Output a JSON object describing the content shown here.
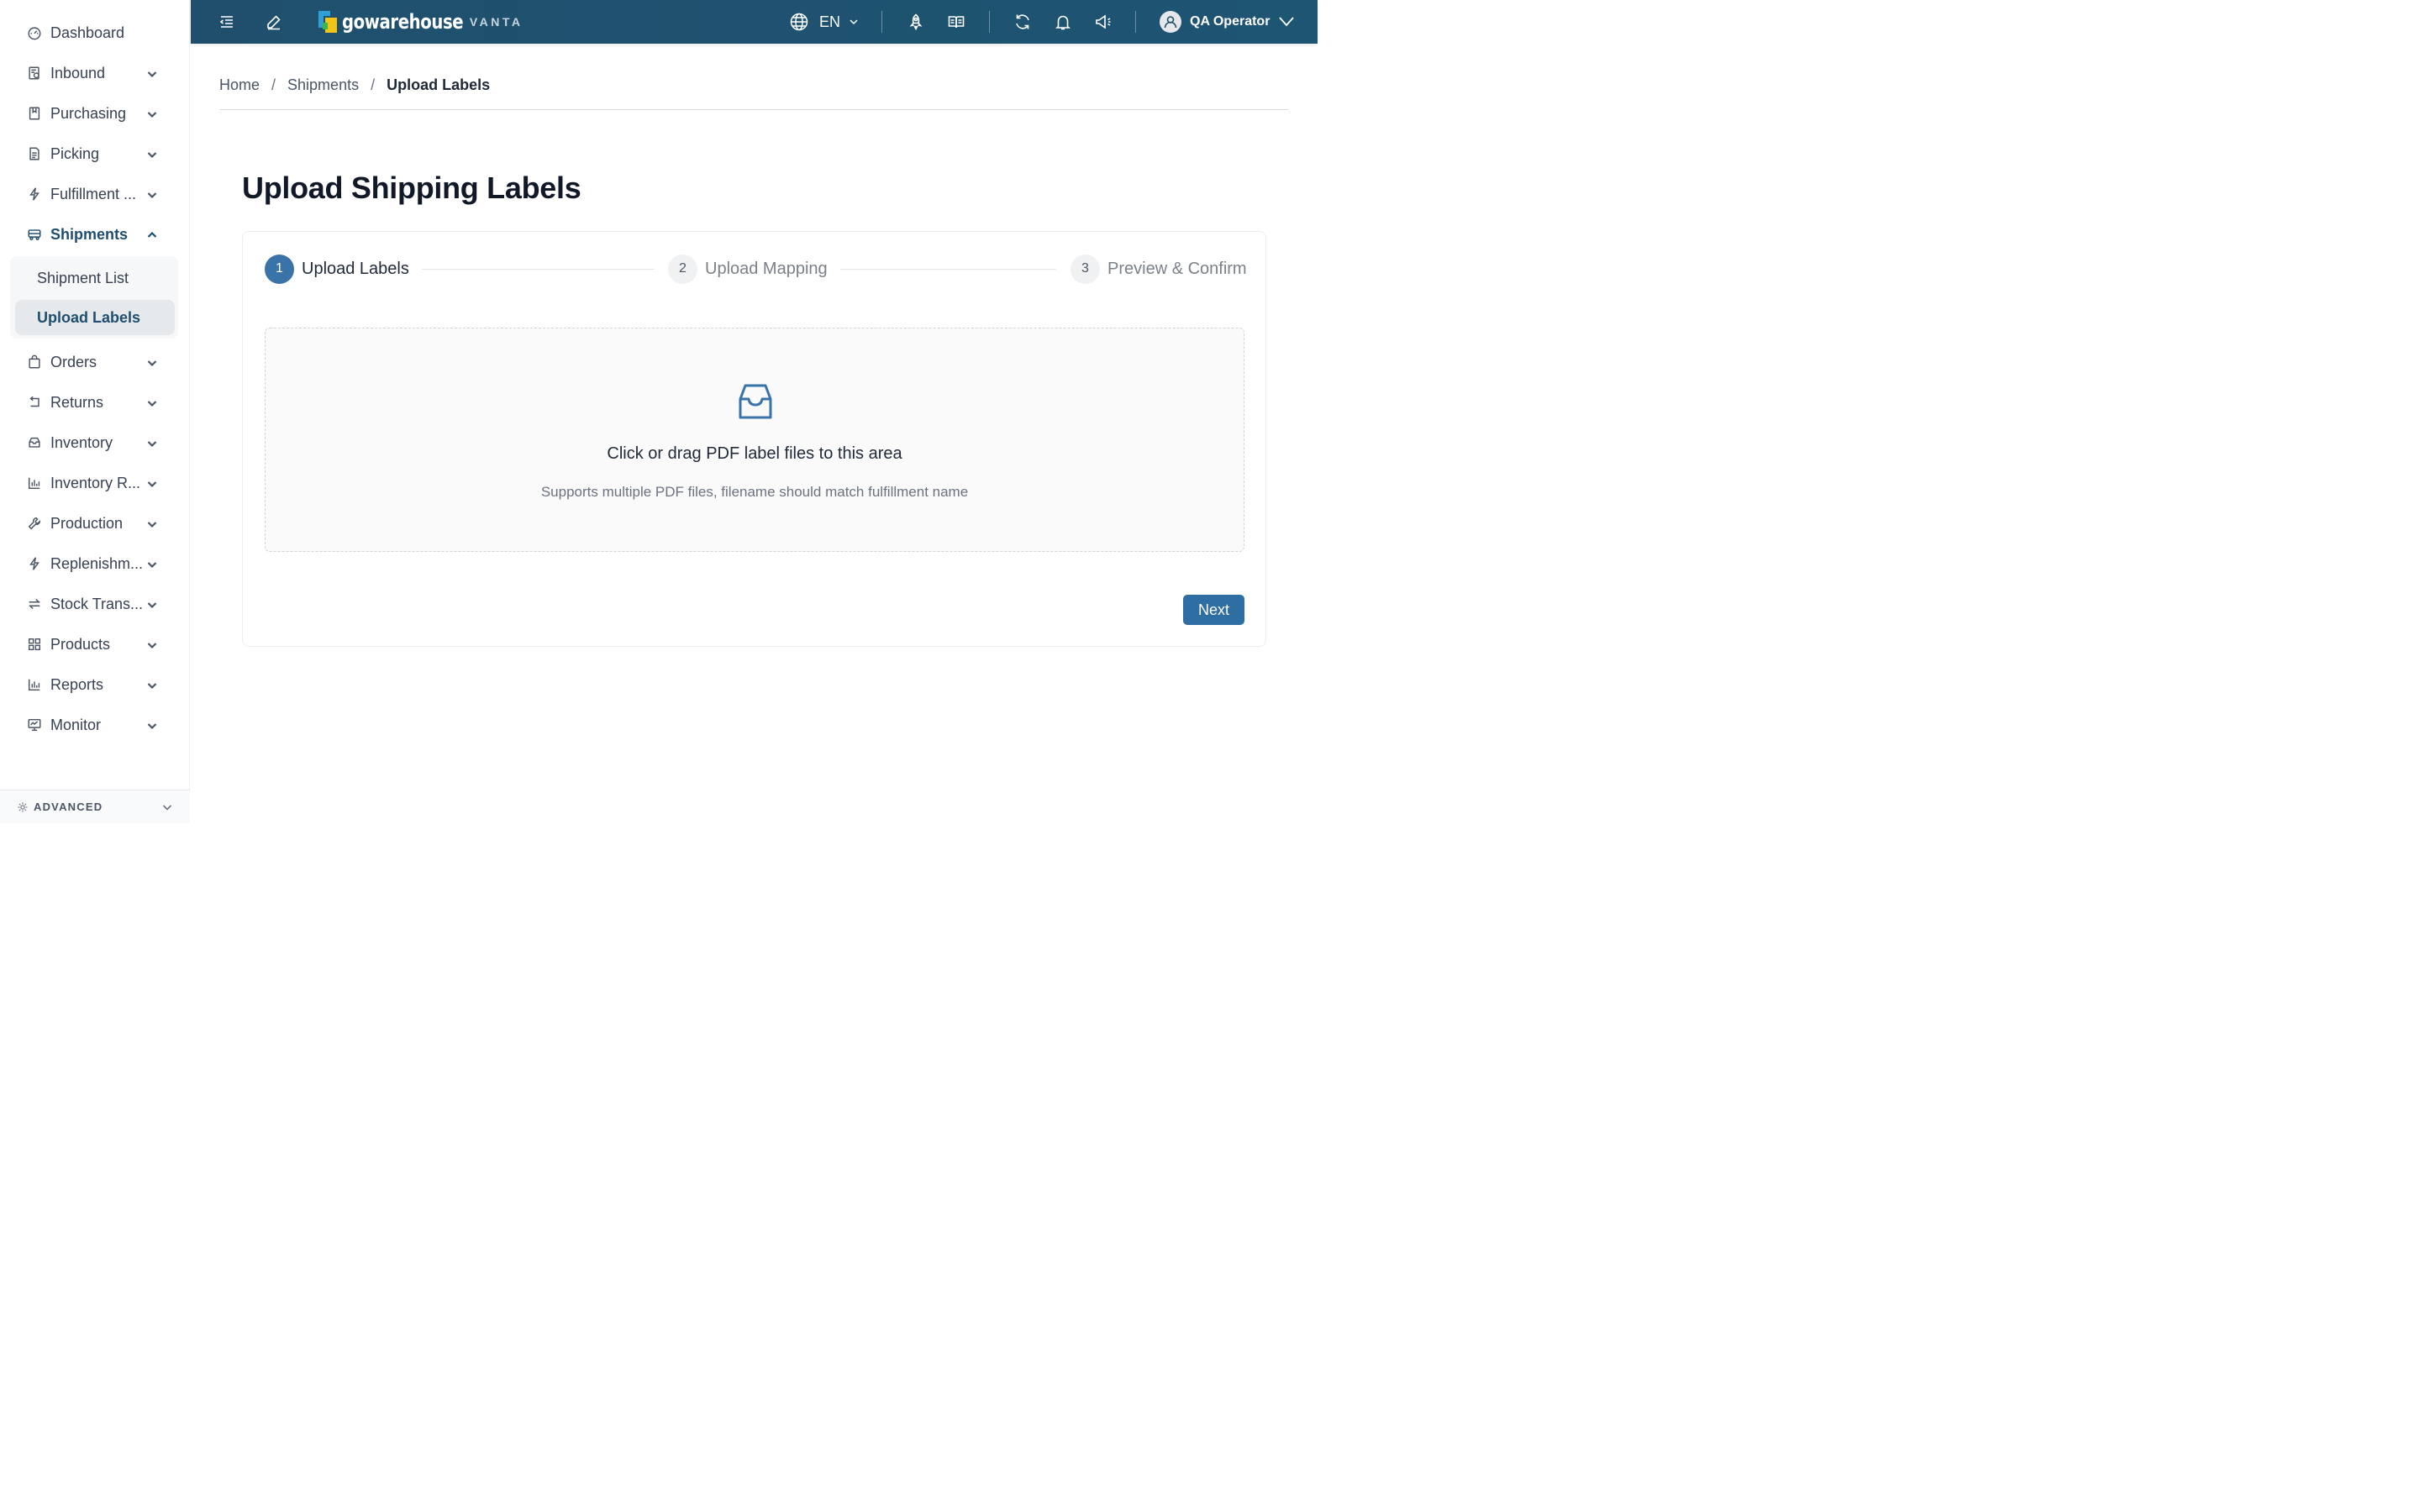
{
  "sidebar": {
    "items": [
      {
        "label": "Dashboard",
        "icon": "dashboard-icon"
      },
      {
        "label": "Inbound",
        "icon": "inbound-icon"
      },
      {
        "label": "Purchasing",
        "icon": "purchasing-icon"
      },
      {
        "label": "Picking",
        "icon": "picking-icon"
      },
      {
        "label": "Fulfillment ...",
        "icon": "lightning-icon"
      },
      {
        "label": "Shipments",
        "icon": "truck-icon"
      },
      {
        "label": "Orders",
        "icon": "shopping-bag-icon"
      },
      {
        "label": "Returns",
        "icon": "return-icon"
      },
      {
        "label": "Inventory",
        "icon": "inbox-icon"
      },
      {
        "label": "Inventory R...",
        "icon": "bar-chart-icon"
      },
      {
        "label": "Production",
        "icon": "wrench-icon"
      },
      {
        "label": "Replenishm...",
        "icon": "lightning-icon"
      },
      {
        "label": "Stock Trans...",
        "icon": "swap-icon"
      },
      {
        "label": "Products",
        "icon": "grid-icon"
      },
      {
        "label": "Reports",
        "icon": "bar-chart-icon"
      },
      {
        "label": "Monitor",
        "icon": "monitor-icon"
      }
    ],
    "shipments_sub": [
      {
        "label": "Shipment List"
      },
      {
        "label": "Upload Labels"
      }
    ],
    "advanced_label": "ADVANCED"
  },
  "header": {
    "logo_text": "gowarehouse",
    "logo_sub": "VANTA",
    "language": "EN",
    "user_name": "QA Operator",
    "colors": {
      "bar": "#1f4f6d",
      "accent": "#3a73a8"
    }
  },
  "breadcrumb": {
    "home": "Home",
    "section": "Shipments",
    "current": "Upload Labels"
  },
  "page": {
    "title": "Upload Shipping Labels",
    "steps": [
      {
        "num": "1",
        "label": "Upload Labels",
        "state": "current"
      },
      {
        "num": "2",
        "label": "Upload Mapping",
        "state": "pending"
      },
      {
        "num": "3",
        "label": "Preview & Confirm",
        "state": "pending"
      }
    ],
    "dropzone": {
      "title": "Click or drag PDF label files to this area",
      "hint": "Supports multiple PDF files, filename should match fulfillment name"
    },
    "next_label": "Next"
  }
}
